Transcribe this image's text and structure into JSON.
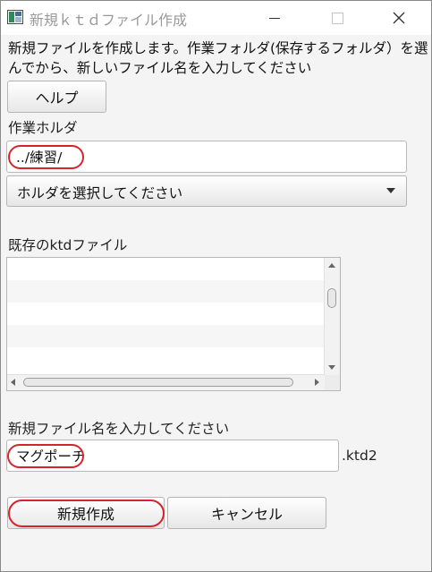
{
  "window": {
    "title": "新規ｋｔｄファイル作成"
  },
  "description": "新規ファイルを作成します。作業フォルダ(保存するフォルダ）を選んでから、新しいファイル名を入力してください",
  "help_button": "ヘルプ",
  "folder": {
    "label": "作業ホルダ",
    "value": "../練習/",
    "select_placeholder": "ホルダを選択してください"
  },
  "existing_files": {
    "label": "既存のktdファイル",
    "items": []
  },
  "new_file": {
    "label": "新規ファイル名を入力してください",
    "value": "マグポーチ",
    "extension": ".ktd2"
  },
  "buttons": {
    "create": "新規作成",
    "cancel": "キャンセル"
  },
  "colors": {
    "highlight": "#d6252a",
    "title_text": "#9a9a9a"
  },
  "icons": [
    "app-icon",
    "minimize-icon",
    "maximize-icon",
    "close-icon",
    "chevron-down-icon"
  ]
}
